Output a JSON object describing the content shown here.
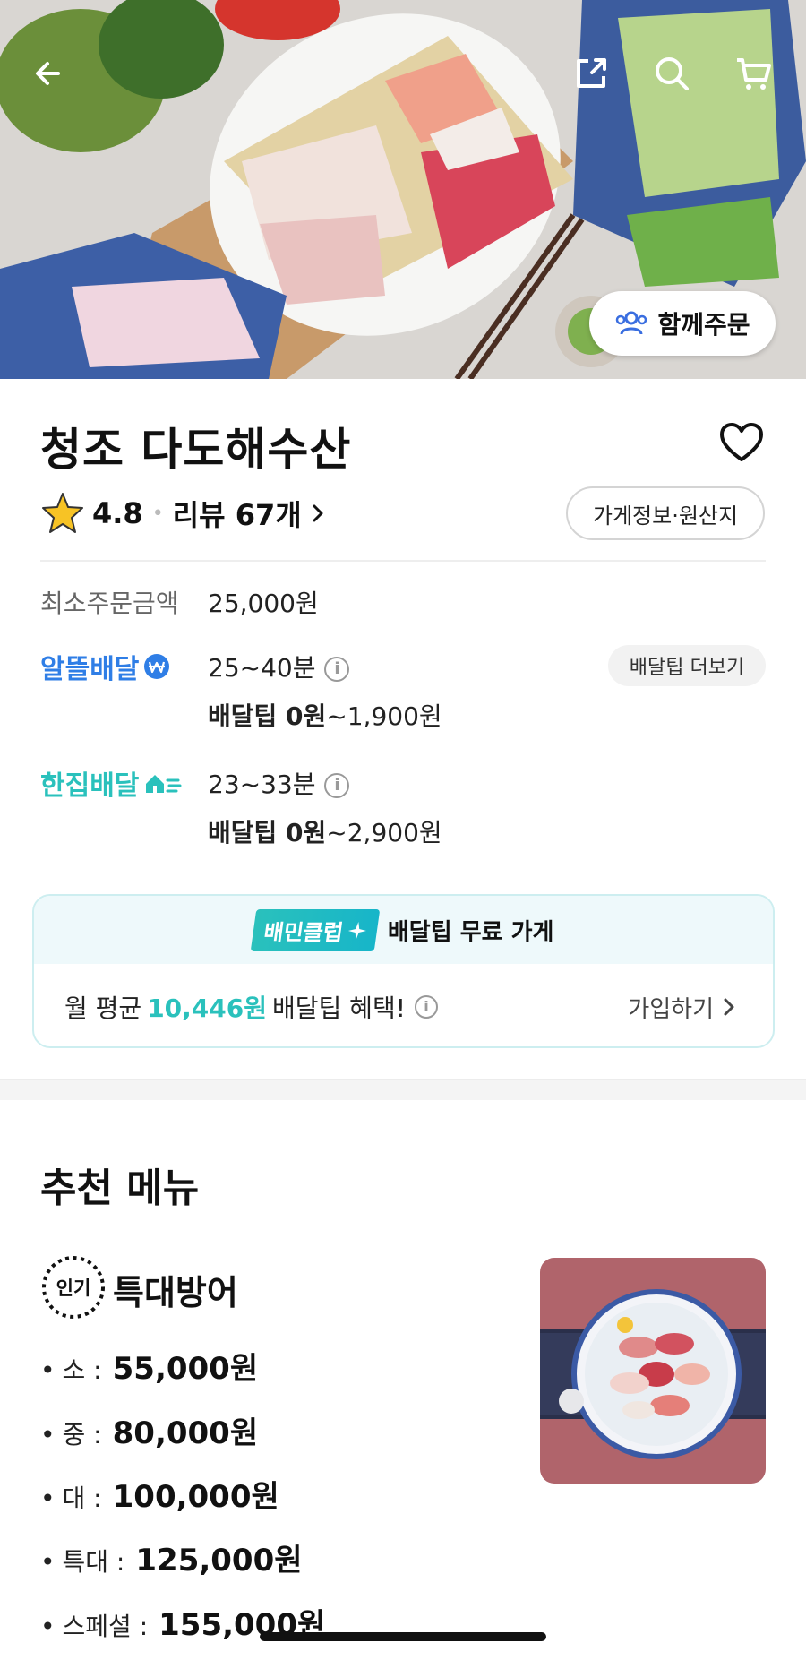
{
  "header": {
    "back_icon": "arrow-left-icon",
    "share_icon": "share-icon",
    "search_icon": "search-icon",
    "cart_icon": "cart-icon",
    "together_order_label": "함께주문"
  },
  "store": {
    "name": "청조 다도해수산",
    "rating": "4.8",
    "review_label": "리뷰 67개",
    "info_button_label": "가게정보·원산지",
    "min_order_label": "최소주문금액",
    "min_order_value": "25,000원"
  },
  "delivery": {
    "economy": {
      "label": "알뜰배달",
      "time": "25~40분",
      "tip_bold": "배달팁 0원",
      "tip_rest": "~1,900원"
    },
    "single": {
      "label": "한집배달",
      "time": "23~33분",
      "tip_bold": "배달팁 0원",
      "tip_rest": "~2,900원"
    },
    "more_tip_label": "배달팁 더보기"
  },
  "club": {
    "badge": "배민클럽",
    "title": "배달팁 무료 가게",
    "benefit_prefix": "월 평균",
    "benefit_amount": "10,446원",
    "benefit_suffix": "배달팁 혜택!",
    "join_label": "가입하기"
  },
  "recommended": {
    "title": "추천 메뉴",
    "item": {
      "badge": "인기",
      "name": "특대방어",
      "prices": [
        {
          "size": "소 :",
          "price": "55,000원"
        },
        {
          "size": "중 :",
          "price": "80,000원"
        },
        {
          "size": "대 :",
          "price": "100,000원"
        },
        {
          "size": "특대 :",
          "price": "125,000원"
        },
        {
          "size": "스페셜 :",
          "price": "155,000원"
        }
      ]
    }
  },
  "colors": {
    "economy_blue": "#2f7ee6",
    "single_mint": "#2ac1bc",
    "club_bg": "#eef9fb"
  }
}
